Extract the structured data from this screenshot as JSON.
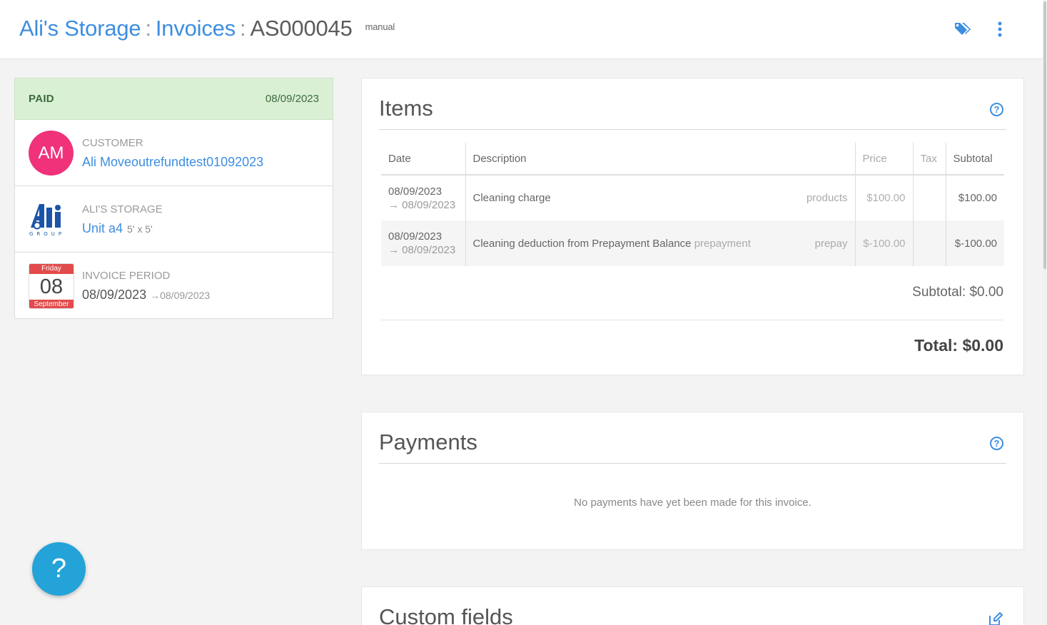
{
  "header": {
    "breadcrumb_store": "Ali's Storage",
    "breadcrumb_sep1": ":",
    "breadcrumb_section": "Invoices",
    "breadcrumb_sep2": ":",
    "invoice_number": "AS000045",
    "invoice_type": "manual",
    "icons": [
      "tags-icon",
      "more-vertical-icon"
    ],
    "accent_color": "#3d8ee0"
  },
  "summary": {
    "status": "PAID",
    "status_date": "08/09/2023",
    "status_color": "#d9f0d5",
    "customer_label": "CUSTOMER",
    "customer_initials": "AM",
    "customer_name": "Ali Moveoutrefundtest01092023",
    "avatar_color": "#f0327a",
    "site_label": "ALI'S STORAGE",
    "unit_name": "Unit a4",
    "unit_size": "5' x 5'",
    "period_label": "INVOICE PERIOD",
    "calendar_weekday": "Friday",
    "calendar_day": "08",
    "calendar_month": "September",
    "period_start": "08/09/2023",
    "period_arrow": "→",
    "period_end": "08/09/2023"
  },
  "items_panel": {
    "title": "Items",
    "columns": [
      "Date",
      "Description",
      "Price",
      "Tax",
      "Subtotal"
    ],
    "rows": [
      {
        "date_from": "08/09/2023",
        "date_to": "→ 08/09/2023",
        "description": "Cleaning charge",
        "description_tag": "",
        "category": "products",
        "price": "$100.00",
        "tax": "",
        "subtotal": "$100.00"
      },
      {
        "date_from": "08/09/2023",
        "date_to": "→ 08/09/2023",
        "description": "Cleaning deduction from Prepayment Balance",
        "description_tag": "prepayment",
        "category": "prepay",
        "price": "$-100.00",
        "tax": "",
        "subtotal": "$-100.00"
      }
    ],
    "subtotal_text": "Subtotal: $0.00",
    "total_text": "Total: $0.00"
  },
  "payments_panel": {
    "title": "Payments",
    "empty_message": "No payments have yet been made for this invoice."
  },
  "custom_fields_panel": {
    "title": "Custom fields"
  },
  "help_button": {
    "label": "?",
    "color": "#23a3d8"
  },
  "logo": {
    "text": "GROUP"
  }
}
